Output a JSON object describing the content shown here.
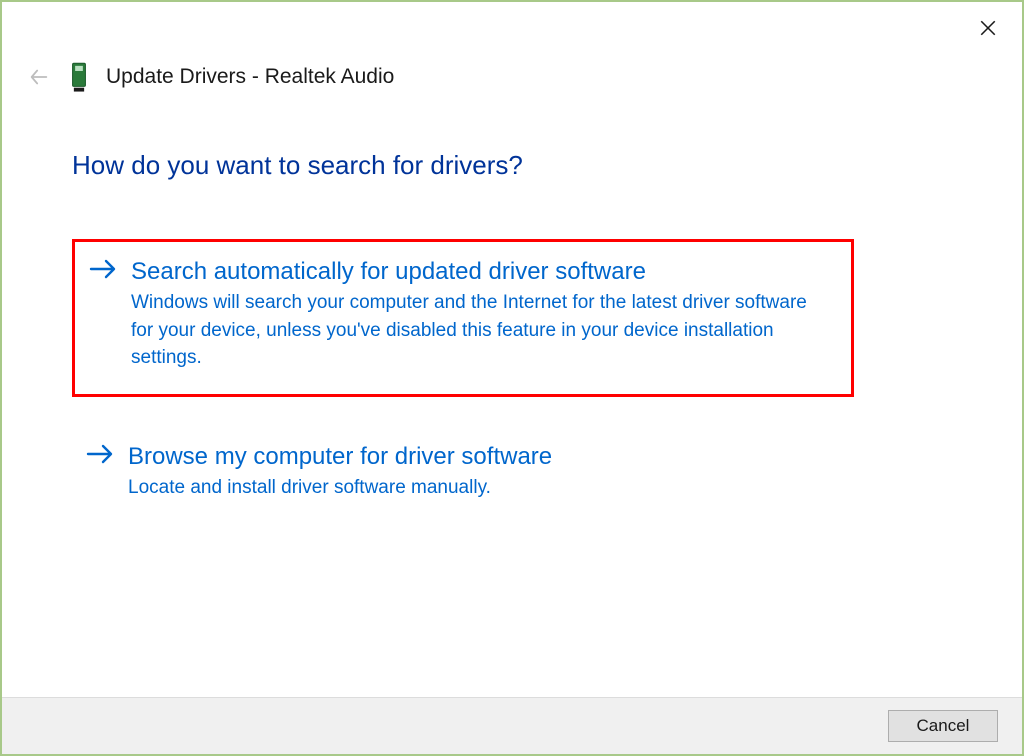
{
  "window": {
    "title": "Update Drivers - Realtek Audio"
  },
  "heading": "How do you want to search for drivers?",
  "options": [
    {
      "title": "Search automatically for updated driver software",
      "description": "Windows will search your computer and the Internet for the latest driver software for your device, unless you've disabled this feature in your device installation settings."
    },
    {
      "title": "Browse my computer for driver software",
      "description": "Locate and install driver software manually."
    }
  ],
  "footer": {
    "cancel_label": "Cancel"
  }
}
